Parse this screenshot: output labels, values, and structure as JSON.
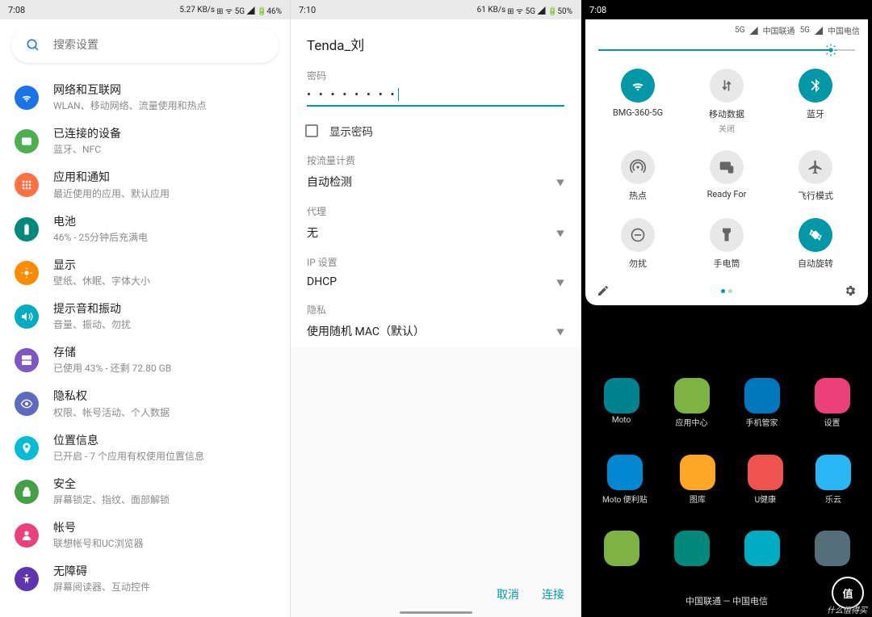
{
  "p1": {
    "status": {
      "time": "7:08",
      "net": "5.27 KB/s",
      "icons": "⊞ ᯤ 5G ◢ 🔋46%"
    },
    "search_placeholder": "搜索设置",
    "items": [
      {
        "title": "网络和互联网",
        "sub": "WLAN、移动网络、流量使用和热点",
        "color": "#1a73e8",
        "name": "network"
      },
      {
        "title": "已连接的设备",
        "sub": "蓝牙、NFC",
        "color": "#4caf50",
        "name": "connected"
      },
      {
        "title": "应用和通知",
        "sub": "最近使用的应用、默认应用",
        "color": "#ff7043",
        "name": "apps"
      },
      {
        "title": "电池",
        "sub": "46% - 25分钟后充满电",
        "color": "#00897b",
        "name": "battery"
      },
      {
        "title": "显示",
        "sub": "壁纸、休眠、字体大小",
        "color": "#fb8c00",
        "name": "display"
      },
      {
        "title": "提示音和振动",
        "sub": "音量、振动、勿扰",
        "color": "#00acc1",
        "name": "sound"
      },
      {
        "title": "存储",
        "sub": "已使用 43% - 还剩 72.80 GB",
        "color": "#7e57c2",
        "name": "storage"
      },
      {
        "title": "隐私权",
        "sub": "权限、帐号活动、个人数据",
        "color": "#5c6bc0",
        "name": "privacy"
      },
      {
        "title": "位置信息",
        "sub": "已开启 - 7 个应用有权使用位置信息",
        "color": "#00bcd4",
        "name": "location"
      },
      {
        "title": "安全",
        "sub": "屏幕锁定、指纹、面部解锁",
        "color": "#43a047",
        "name": "security"
      },
      {
        "title": "帐号",
        "sub": "联想帐号和UC浏览器",
        "color": "#ec407a",
        "name": "accounts"
      },
      {
        "title": "无障碍",
        "sub": "屏幕阅读器、互动控件",
        "color": "#5e35b1",
        "name": "accessibility"
      }
    ]
  },
  "p2": {
    "status": {
      "time": "7:10",
      "net": "61 KB/s",
      "icons": "⊞ ᯤ 5G ◢ 🔋50%"
    },
    "ssid": "Tenda_刘",
    "pwd_label": "密码",
    "pwd_value": "• • • • • • • •",
    "show_pwd": "显示密码",
    "fields": [
      {
        "label": "按流量计费",
        "value": "自动检测",
        "name": "metered"
      },
      {
        "label": "代理",
        "value": "无",
        "name": "proxy"
      },
      {
        "label": "IP 设置",
        "value": "DHCP",
        "name": "ip"
      },
      {
        "label": "隐私",
        "value": "使用随机 MAC（默认）",
        "name": "privacy-mac"
      }
    ],
    "cancel": "取消",
    "connect": "连接"
  },
  "p3": {
    "status": {
      "time": "7:08"
    },
    "carriers": [
      "5G",
      "中国联通",
      "5G",
      "中国电信"
    ],
    "tiles": [
      {
        "label": "BMG-360-5G",
        "sub": "",
        "on": true,
        "name": "wifi"
      },
      {
        "label": "移动数据",
        "sub": "关闭",
        "on": false,
        "name": "data"
      },
      {
        "label": "蓝牙",
        "sub": "",
        "on": true,
        "name": "bluetooth"
      },
      {
        "label": "热点",
        "sub": "",
        "on": false,
        "name": "hotspot"
      },
      {
        "label": "Ready For",
        "sub": "",
        "on": false,
        "name": "readyfor"
      },
      {
        "label": "飞行模式",
        "sub": "",
        "on": false,
        "name": "airplane"
      },
      {
        "label": "勿扰",
        "sub": "",
        "on": false,
        "name": "dnd"
      },
      {
        "label": "手电筒",
        "sub": "",
        "on": false,
        "name": "flashlight"
      },
      {
        "label": "自动旋转",
        "sub": "",
        "on": true,
        "name": "rotate"
      }
    ],
    "home_rows": [
      [
        {
          "l": "Moto",
          "c": "#00838f"
        },
        {
          "l": "应用中心",
          "c": "#7cb342"
        },
        {
          "l": "手机管家",
          "c": "#0277bd"
        },
        {
          "l": "设置",
          "c": "#ec407a"
        }
      ],
      [
        {
          "l": "Moto 便利贴",
          "c": "#0288d1"
        },
        {
          "l": "图库",
          "c": "#ffa726"
        },
        {
          "l": "U健康",
          "c": "#ef5350"
        },
        {
          "l": "乐云",
          "c": "#29b6f6"
        }
      ]
    ],
    "dock": [
      {
        "c": "#7cb342"
      },
      {
        "c": "#00897b"
      },
      {
        "c": "#00acc1"
      },
      {
        "c": "#546e7a"
      }
    ],
    "carrier_text": "中国联通 — 中国电信"
  },
  "watermark": "值"
}
